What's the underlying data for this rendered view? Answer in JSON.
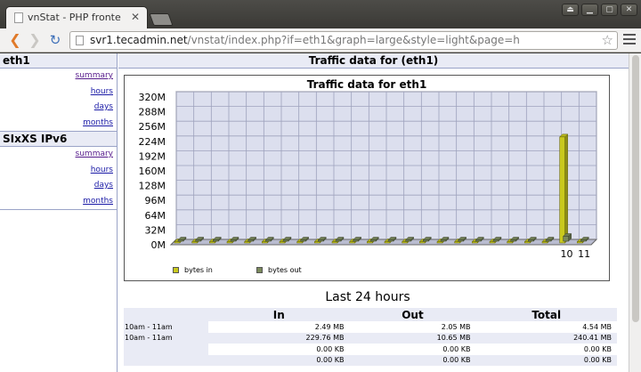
{
  "browser": {
    "tab_title": "vnStat - PHP fronte",
    "tab_close": "✕",
    "url_host": "svr1.tecadmin.net",
    "url_path": "/vnstat/index.php?if=eth1&graph=large&style=light&page=h",
    "window_buttons": [
      "⏏",
      "▁",
      "▢",
      "✕"
    ]
  },
  "sidebar": {
    "interfaces": [
      {
        "name": "eth1",
        "links": [
          "summary",
          "hours",
          "days",
          "months"
        ]
      },
      {
        "name": "SIxXS IPv6",
        "links": [
          "summary",
          "hours",
          "days",
          "months"
        ]
      }
    ]
  },
  "main": {
    "header": "Traffic data for (eth1)",
    "section_title": "Last 24 hours"
  },
  "chart_data": {
    "type": "bar",
    "title": "Traffic data for eth1",
    "y_ticks": [
      "0M",
      "32M",
      "64M",
      "96M",
      "128M",
      "160M",
      "192M",
      "224M",
      "256M",
      "288M",
      "320M"
    ],
    "ylim": [
      0,
      320
    ],
    "x_tick_labels": [
      {
        "index": 22,
        "label": "10"
      },
      {
        "index": 23,
        "label": "11"
      }
    ],
    "series": [
      {
        "name": "bytes in",
        "color": "#c9c91e",
        "values": [
          0,
          0,
          0,
          0,
          0,
          0,
          0,
          0,
          0,
          0,
          0,
          0,
          0,
          0,
          0,
          0,
          0,
          0,
          0,
          0,
          0,
          0,
          229.76,
          2.49
        ]
      },
      {
        "name": "bytes out",
        "color": "#7b8a5c",
        "values": [
          0,
          0,
          0,
          0,
          0,
          0,
          0,
          0,
          0,
          0,
          0,
          0,
          0,
          0,
          0,
          0,
          0,
          0,
          0,
          0,
          0,
          0,
          10.65,
          2.05
        ]
      }
    ],
    "grid": true,
    "legend": "bottom-left"
  },
  "table": {
    "headers": [
      "",
      "In",
      "Out",
      "Total"
    ],
    "rows": [
      [
        "10am - 11am",
        "2.49 MB",
        "2.05 MB",
        "4.54 MB"
      ],
      [
        "10am - 11am",
        "229.76 MB",
        "10.65 MB",
        "240.41 MB"
      ],
      [
        "",
        "0.00 KB",
        "0.00 KB",
        "0.00 KB"
      ],
      [
        "",
        "0.00 KB",
        "0.00 KB",
        "0.00 KB"
      ]
    ]
  }
}
